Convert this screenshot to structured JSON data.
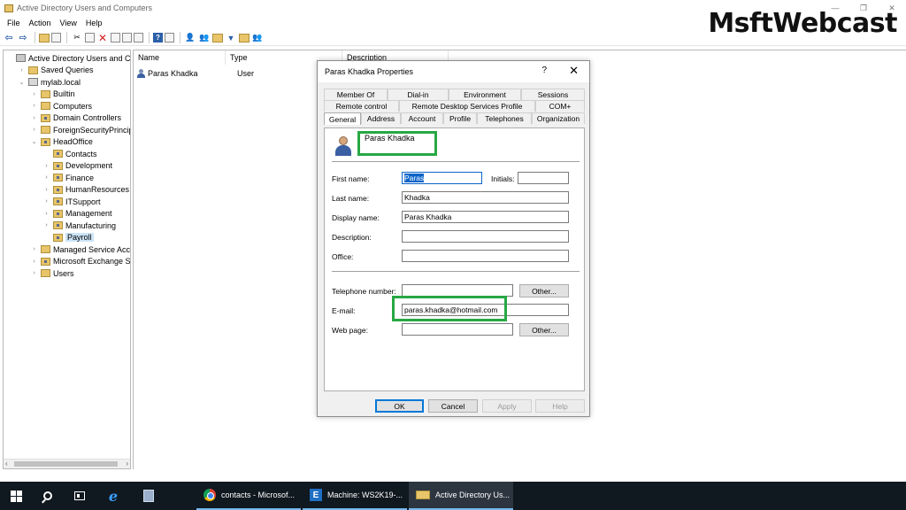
{
  "window": {
    "title": "Active Directory Users and Computers",
    "controls": [
      "—",
      "❐",
      "✕"
    ]
  },
  "watermark": "MsftWebcast",
  "menu": [
    "File",
    "Action",
    "View",
    "Help"
  ],
  "tree": [
    {
      "label": "Active Directory Users and Com",
      "depth": 0,
      "expander": "",
      "icon": "root"
    },
    {
      "label": "Saved Queries",
      "depth": 1,
      "expander": "›",
      "icon": "folder"
    },
    {
      "label": "mylab.local",
      "depth": 1,
      "expander": "⌄",
      "icon": "domain"
    },
    {
      "label": "Builtin",
      "depth": 2,
      "expander": "›",
      "icon": "folder"
    },
    {
      "label": "Computers",
      "depth": 2,
      "expander": "›",
      "icon": "folder"
    },
    {
      "label": "Domain Controllers",
      "depth": 2,
      "expander": "›",
      "icon": "ou"
    },
    {
      "label": "ForeignSecurityPrincipals",
      "depth": 2,
      "expander": "›",
      "icon": "folder"
    },
    {
      "label": "HeadOffice",
      "depth": 2,
      "expander": "⌄",
      "icon": "ou"
    },
    {
      "label": "Contacts",
      "depth": 3,
      "expander": "",
      "icon": "ou"
    },
    {
      "label": "Development",
      "depth": 3,
      "expander": "›",
      "icon": "ou"
    },
    {
      "label": "Finance",
      "depth": 3,
      "expander": "›",
      "icon": "ou"
    },
    {
      "label": "HumanResources",
      "depth": 3,
      "expander": "›",
      "icon": "ou"
    },
    {
      "label": "ITSupport",
      "depth": 3,
      "expander": "›",
      "icon": "ou"
    },
    {
      "label": "Management",
      "depth": 3,
      "expander": "›",
      "icon": "ou"
    },
    {
      "label": "Manufacturing",
      "depth": 3,
      "expander": "›",
      "icon": "ou"
    },
    {
      "label": "Payroll",
      "depth": 3,
      "expander": "",
      "icon": "ou",
      "selected": true
    },
    {
      "label": "Managed Service Accour",
      "depth": 2,
      "expander": "›",
      "icon": "folder"
    },
    {
      "label": "Microsoft Exchange Secu",
      "depth": 2,
      "expander": "›",
      "icon": "ou"
    },
    {
      "label": "Users",
      "depth": 2,
      "expander": "›",
      "icon": "folder"
    }
  ],
  "list": {
    "columns": [
      "Name",
      "Type",
      "Description"
    ],
    "rows": [
      {
        "name": "Paras Khadka",
        "type": "User"
      }
    ]
  },
  "dialog": {
    "title": "Paras Khadka Properties",
    "help": "?",
    "close": "✕",
    "tabs_row1": [
      "Member Of",
      "Dial-in",
      "Environment",
      "Sessions"
    ],
    "tabs_row2": [
      "Remote control",
      "Remote Desktop Services Profile",
      "COM+"
    ],
    "tabs_row3": [
      "General",
      "Address",
      "Account",
      "Profile",
      "Telephones",
      "Organization"
    ],
    "active_tab": "General",
    "display": "Paras Khadka",
    "labels": {
      "first_name": "First name:",
      "initials": "Initials:",
      "last_name": "Last name:",
      "display_name": "Display name:",
      "description": "Description:",
      "office": "Office:",
      "telephone": "Telephone number:",
      "email": "E-mail:",
      "web_page": "Web page:"
    },
    "values": {
      "first_name": "Paras",
      "initials": "",
      "last_name": "Khadka",
      "display_name": "Paras Khadka",
      "description": "",
      "office": "",
      "telephone": "",
      "email": "paras.khadka@hotmail.com",
      "web_page": ""
    },
    "buttons": {
      "other_phone": "Other...",
      "other_web": "Other...",
      "ok": "OK",
      "cancel": "Cancel",
      "apply": "Apply",
      "help": "Help"
    },
    "highlight_color": "#27a844"
  },
  "taskbar": {
    "items": [
      {
        "label": "contacts - Microsof...",
        "icon": "chrome-icon"
      },
      {
        "label": "Machine: WS2K19-...",
        "icon": "exchange-icon"
      },
      {
        "label": "Active Directory Us...",
        "icon": "ad-icon"
      }
    ]
  }
}
